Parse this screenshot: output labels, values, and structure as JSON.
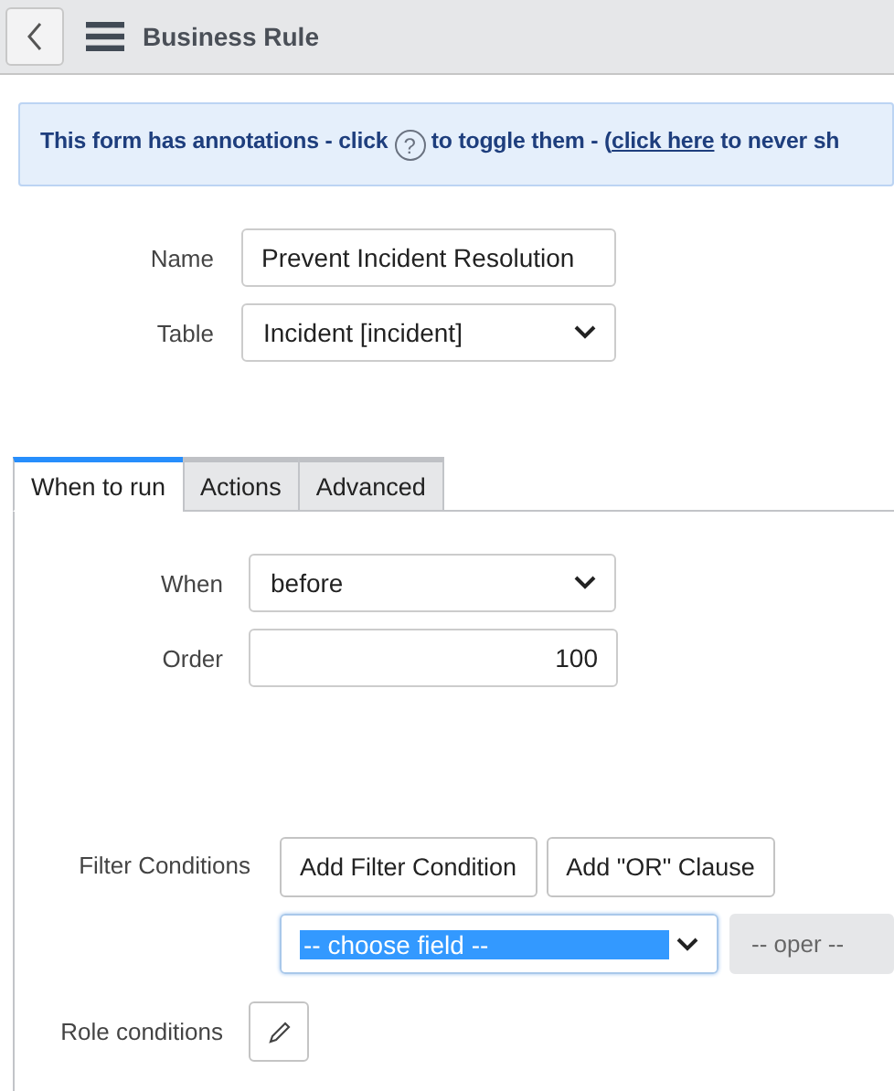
{
  "header": {
    "title": "Business Rule"
  },
  "banner": {
    "before_icon": "This form has annotations - click",
    "help_glyph": "?",
    "after_icon": "to toggle them - (",
    "link": "click here",
    "after_link": "to never sh"
  },
  "fields": [
    {
      "label": "Name",
      "kind": "text",
      "value": "Prevent Incident Resolution"
    },
    {
      "label": "Table",
      "kind": "select",
      "value": "Incident [incident]"
    }
  ],
  "tabs": [
    {
      "label": "When to run",
      "selected": true
    },
    {
      "label": "Actions",
      "selected": false
    },
    {
      "label": "Advanced",
      "selected": false
    }
  ],
  "when_fields": [
    {
      "label": "When",
      "kind": "select",
      "value": "before"
    },
    {
      "label": "Order",
      "kind": "number",
      "value": "100"
    }
  ],
  "filter": {
    "label": "Filter Conditions",
    "buttons": [
      "Add Filter Condition",
      "Add \"OR\" Clause"
    ],
    "field_select": {
      "value": "-- choose field --",
      "highlighted": true
    },
    "operator": {
      "value": "-- oper --",
      "disabled": true
    }
  },
  "role": {
    "label": "Role conditions"
  }
}
